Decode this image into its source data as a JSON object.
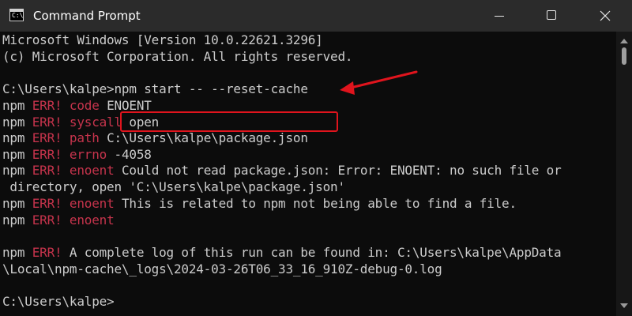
{
  "window": {
    "title": "Command Prompt",
    "app_icon_glyph": "C:\\"
  },
  "console": {
    "header_line1": "Microsoft Windows [Version 10.0.22621.3296]",
    "header_line2": "(c) Microsoft Corporation. All rights reserved.",
    "prompt": "C:\\Users\\kalpe>",
    "command": "npm start -- --reset-cache",
    "npm_prefix": "npm",
    "err_tag": "ERR!",
    "errors": [
      {
        "key": "code",
        "value": " ENOENT"
      },
      {
        "key": "syscall",
        "value": " open"
      },
      {
        "key": "path",
        "value": " C:\\Users\\kalpe\\package.json"
      },
      {
        "key": "errno",
        "value": " -4058"
      },
      {
        "key": "enoent",
        "value": " Could not read package.json: Error: ENOENT: no such file or"
      }
    ],
    "wrap_line": " directory, open 'C:\\Users\\kalpe\\package.json'",
    "error_related": {
      "key": "enoent",
      "value": " This is related to npm not being able to find a file."
    },
    "error_empty": {
      "key": "enoent",
      "value": ""
    },
    "log_line1": " A complete log of this run can be found in: C:\\Users\\kalpe\\AppData",
    "log_line2": "\\Local\\npm-cache\\_logs\\2024-03-26T06_33_16_910Z-debug-0.log",
    "final_prompt": "C:\\Users\\kalpe>"
  },
  "colors": {
    "background": "#0c0c0c",
    "titlebar": "#2b2b2b",
    "text": "#cccccc",
    "error": "#c6344c",
    "annotation": "#e0141d"
  },
  "icons": {
    "minimize": "minimize-icon",
    "maximize": "maximize-icon",
    "close": "close-icon"
  }
}
